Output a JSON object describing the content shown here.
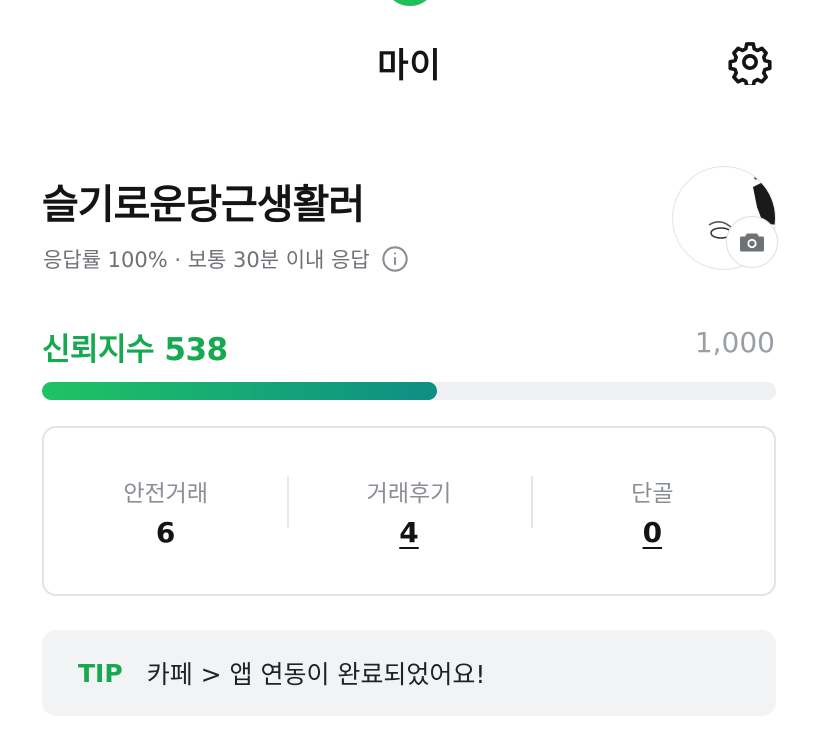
{
  "header": {
    "title": "마이"
  },
  "profile": {
    "nickname": "슬기로운당근생활러",
    "response": "응답률 100% · 보통 30분 이내 응답"
  },
  "trust": {
    "label": "신뢰지수 538",
    "max": "1,000",
    "score": 538,
    "max_value": 1000
  },
  "stats": [
    {
      "label": "안전거래",
      "value": "6"
    },
    {
      "label": "거래후기",
      "value": "4"
    },
    {
      "label": "단골",
      "value": "0"
    }
  ],
  "tip": {
    "tag": "TIP",
    "text": "카페 > 앱 연동이 완료되었어요!"
  },
  "icons": {
    "settings": "gear-icon",
    "info": "info-icon",
    "camera": "camera-icon"
  },
  "colors": {
    "accent": "#16a950",
    "progress_start": "#1fc364",
    "progress_end": "#0e8e84",
    "muted": "#6e7176"
  }
}
